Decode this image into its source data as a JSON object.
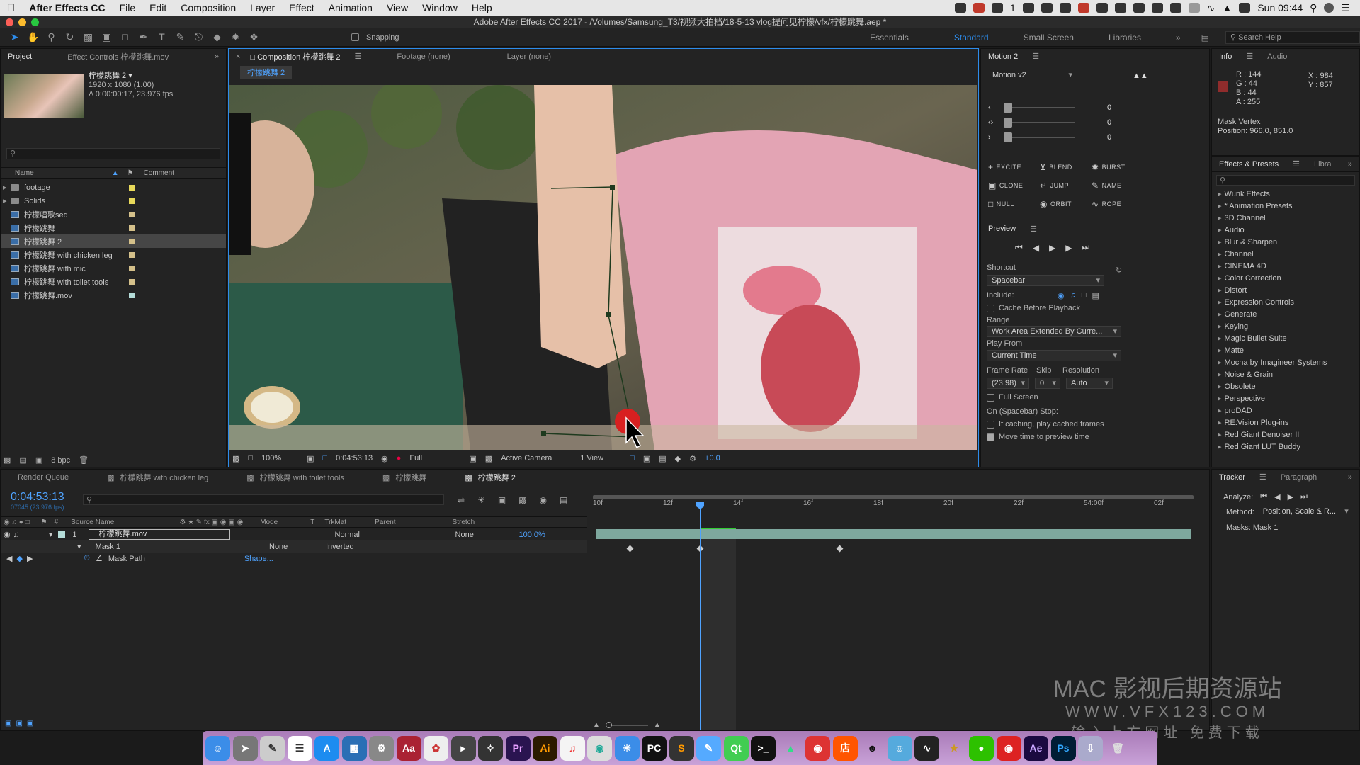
{
  "menubar": {
    "app_name": "After Effects CC",
    "menus": [
      "File",
      "Edit",
      "Composition",
      "Layer",
      "Effect",
      "Animation",
      "View",
      "Window",
      "Help"
    ],
    "badge_count": "1",
    "clock": "Sun 09:44"
  },
  "window_title": "Adobe After Effects CC 2017 - /Volumes/Samsung_T3/视频大拍档/18-5-13 vlog提问见柠檬/vfx/柠檬跳舞.aep *",
  "toolbar": {
    "snapping_label": "Snapping",
    "workspaces": [
      "Essentials",
      "Standard",
      "Small Screen",
      "Libraries"
    ],
    "active_workspace": "Standard",
    "search_help": "Search Help"
  },
  "project": {
    "tabs": [
      "Project",
      "Effect Controls 柠檬跳舞.mov"
    ],
    "comp_name": "柠檬跳舞 2 ▾",
    "comp_size": "1920 x 1080 (1.00)",
    "comp_duration": "Δ 0;00:00:17, 23.976 fps",
    "search_placeholder": "",
    "col_name": "Name",
    "col_comment": "Comment",
    "items": [
      {
        "name": "footage",
        "type": "folder",
        "color": "#e8d95a"
      },
      {
        "name": "Solids",
        "type": "folder",
        "color": "#e8d95a"
      },
      {
        "name": "柠檬唱歌seq",
        "type": "comp",
        "color": "#d4c08a"
      },
      {
        "name": "柠檬跳舞",
        "type": "comp",
        "color": "#d4c08a"
      },
      {
        "name": "柠檬跳舞 2",
        "type": "comp",
        "color": "#d4c08a"
      },
      {
        "name": "柠檬跳舞 with chicken leg",
        "type": "comp",
        "color": "#d4c08a"
      },
      {
        "name": "柠檬跳舞 with mic",
        "type": "comp",
        "color": "#d4c08a"
      },
      {
        "name": "柠檬跳舞 with toilet tools",
        "type": "comp",
        "color": "#d4c08a"
      },
      {
        "name": "柠檬跳舞.mov",
        "type": "footage",
        "color": "#b4dcd8"
      }
    ],
    "bpc": "8 bpc"
  },
  "composition": {
    "tabs": [
      "Composition 柠檬跳舞 2",
      "Footage (none)",
      "Layer (none)"
    ],
    "active_comp_tab": "柠檬跳舞 2",
    "zoom": "100%",
    "timecode": "0:04:53:13",
    "resolution": "Full",
    "camera": "Active Camera",
    "views": "1 View",
    "exposure": "+0.0"
  },
  "motion": {
    "title": "Motion 2",
    "version": "Motion v2",
    "sliders": [
      {
        "value": "0"
      },
      {
        "value": "0"
      },
      {
        "value": "0"
      }
    ],
    "buttons": [
      [
        "EXCITE",
        "BLEND",
        "BURST"
      ],
      [
        "CLONE",
        "JUMP",
        "NAME"
      ],
      [
        "NULL",
        "ORBIT",
        "ROPE"
      ]
    ]
  },
  "preview": {
    "title": "Preview",
    "shortcut_label": "Shortcut",
    "shortcut": "Spacebar",
    "include_label": "Include:",
    "cache_label": "Cache Before Playback",
    "range_label": "Range",
    "range": "Work Area Extended By Curre...",
    "play_from_label": "Play From",
    "play_from": "Current Time",
    "frame_rate_label": "Frame Rate",
    "skip_label": "Skip",
    "resolution_label": "Resolution",
    "frame_rate": "(23.98)",
    "skip": "0",
    "resolution": "Auto",
    "full_screen_label": "Full Screen",
    "stop_label": "On (Spacebar) Stop:",
    "if_caching_label": "If caching, play cached frames",
    "move_time_label": "Move time to preview time"
  },
  "info": {
    "tabs": [
      "Info",
      "Audio"
    ],
    "r": "R : 144",
    "g": "G : 44",
    "b": "B : 44",
    "a": "A : 255",
    "x": "X : 984",
    "y": "Y : 857",
    "swatch": "#902c2c",
    "vertex_label": "Mask Vertex",
    "vertex_pos": "Position: 966.0, 851.0"
  },
  "effects": {
    "tabs": [
      "Effects & Presets",
      "Libra"
    ],
    "items": [
      "Wunk Effects",
      "* Animation Presets",
      "3D Channel",
      "Audio",
      "Blur & Sharpen",
      "Channel",
      "CINEMA 4D",
      "Color Correction",
      "Distort",
      "Expression Controls",
      "Generate",
      "Keying",
      "Magic Bullet Suite",
      "Matte",
      "Mocha by Imagineer Systems",
      "Noise & Grain",
      "Obsolete",
      "Perspective",
      "proDAD",
      "RE:Vision Plug-ins",
      "Red Giant Denoiser II",
      "Red Giant LUT Buddy"
    ]
  },
  "timeline": {
    "tabs": [
      "Render Queue",
      "柠檬跳舞 with chicken leg",
      "柠檬跳舞 with toilet tools",
      "柠檬跳舞",
      "柠檬跳舞 2"
    ],
    "timecode": "0:04:53:13",
    "frames": "07045 (23.976 fps)",
    "columns": {
      "source": "Source Name",
      "mode": "Mode",
      "t": "T",
      "trkmat": "TrkMat",
      "parent": "Parent",
      "stretch": "Stretch"
    },
    "layer": {
      "num": "1",
      "name": "柠檬跳舞.mov",
      "mode": "Normal",
      "parent": "None",
      "stretch": "100.0%"
    },
    "mask": {
      "name": "Mask 1",
      "mode": "None",
      "inverted": "Inverted"
    },
    "mask_path": {
      "name": "Mask Path",
      "value": "Shape..."
    },
    "ruler": [
      "10f",
      "12f",
      "14f",
      "16f",
      "18f",
      "20f",
      "22f",
      "54:00f",
      "02f"
    ]
  },
  "tracker": {
    "tabs": [
      "Tracker",
      "Paragraph"
    ],
    "analyze_label": "Analyze:",
    "method_label": "Method:",
    "method": "Position, Scale & R...",
    "masks_label": "Masks: Mask 1"
  },
  "watermark": {
    "line1": "MAC 影视后期资源站",
    "line2": "WWW.VFX123.COM",
    "line3": "输入上方网址 免费下载"
  }
}
